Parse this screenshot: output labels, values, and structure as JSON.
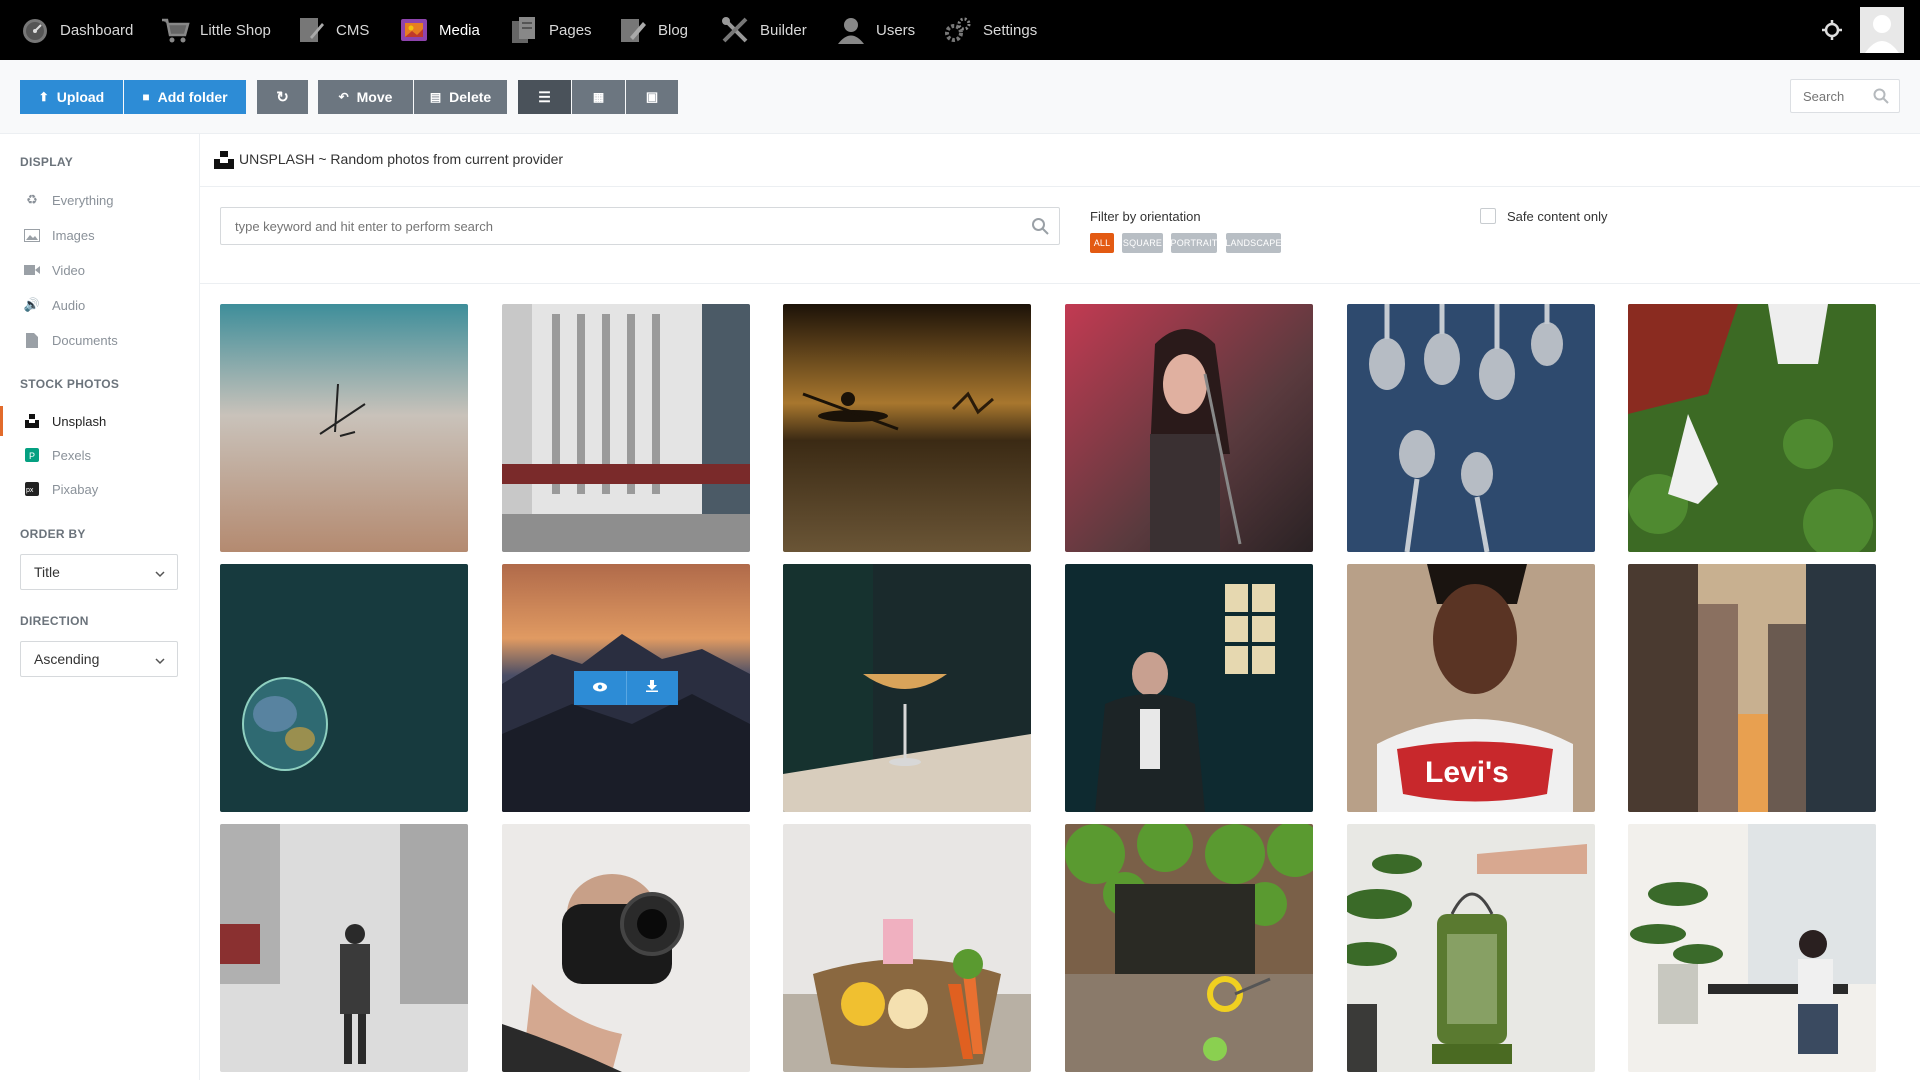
{
  "nav": {
    "items": [
      {
        "label": "Dashboard",
        "icon": "dashboard-icon"
      },
      {
        "label": "Little Shop",
        "icon": "cart-icon"
      },
      {
        "label": "CMS",
        "icon": "cms-icon"
      },
      {
        "label": "Media",
        "icon": "media-icon"
      },
      {
        "label": "Pages",
        "icon": "pages-icon"
      },
      {
        "label": "Blog",
        "icon": "blog-icon"
      },
      {
        "label": "Builder",
        "icon": "builder-icon"
      },
      {
        "label": "Users",
        "icon": "user-icon"
      },
      {
        "label": "Settings",
        "icon": "gear-icon"
      }
    ],
    "active": "Media"
  },
  "toolbar": {
    "upload": "Upload",
    "add_folder": "Add folder",
    "move": "Move",
    "delete": "Delete",
    "search_placeholder": "Search"
  },
  "sidebar": {
    "display_heading": "DISPLAY",
    "display_items": [
      {
        "label": "Everything",
        "icon": "recycle-icon"
      },
      {
        "label": "Images",
        "icon": "image-icon"
      },
      {
        "label": "Video",
        "icon": "video-icon"
      },
      {
        "label": "Audio",
        "icon": "audio-icon"
      },
      {
        "label": "Documents",
        "icon": "document-icon"
      }
    ],
    "stock_heading": "STOCK PHOTOS",
    "stock_items": [
      {
        "label": "Unsplash",
        "icon": "unsplash-icon",
        "active": true
      },
      {
        "label": "Pexels",
        "icon": "pexels-icon"
      },
      {
        "label": "Pixabay",
        "icon": "pixabay-icon"
      }
    ],
    "order_heading": "ORDER BY",
    "order_value": "Title",
    "direction_heading": "DIRECTION",
    "direction_value": "Ascending"
  },
  "main": {
    "title": "UNSPLASH ~ Random photos from current provider",
    "search_placeholder": "type keyword and hit enter to perform search",
    "filter_label": "Filter by orientation",
    "orientation_chips": [
      "ALL",
      "SQUARE",
      "PORTRAIT",
      "LANDSCAPE"
    ],
    "orientation_selected": "ALL",
    "safe_label": "Safe content only",
    "safe_checked": false
  },
  "colors": {
    "accent_blue": "#2d8cd6",
    "accent_orange": "#e35a12",
    "nav_bg": "#000000"
  }
}
